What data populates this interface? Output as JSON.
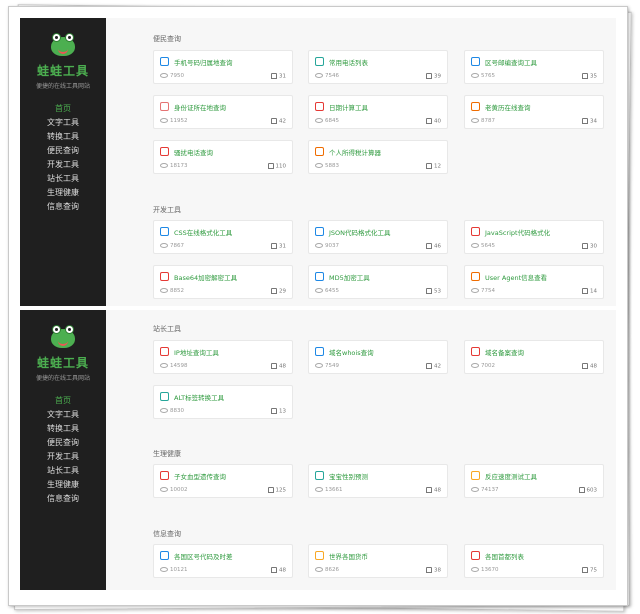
{
  "sidebar": {
    "brand": "蛙蛙工具",
    "slogan": "便捷的在线工具网站",
    "nav": [
      "首页",
      "文字工具",
      "转换工具",
      "便民查询",
      "开发工具",
      "站长工具",
      "生理健康",
      "信息查询"
    ]
  },
  "shot1": {
    "sections": [
      {
        "title": "便民查询",
        "cards": [
          {
            "name": "手机号码归属地查询",
            "views": "7950",
            "likes": "31",
            "icon": "phone-icon",
            "color": "#1e88e5"
          },
          {
            "name": "常用电话列表",
            "views": "7546",
            "likes": "39",
            "icon": "call-icon",
            "color": "#26a69a"
          },
          {
            "name": "区号邮编查询工具",
            "views": "5765",
            "likes": "35",
            "icon": "mail-icon",
            "color": "#1e88e5"
          },
          {
            "name": "身份证所在地查询",
            "views": "11952",
            "likes": "42",
            "icon": "idcard-icon",
            "color": "#e57373"
          },
          {
            "name": "日期计算工具",
            "views": "6845",
            "likes": "40",
            "icon": "calendar-icon",
            "color": "#e53935"
          },
          {
            "name": "老黄历在线查询",
            "views": "8787",
            "likes": "34",
            "icon": "almanac-icon",
            "color": "#ef6c00"
          },
          {
            "name": "骚扰电话查询",
            "views": "18173",
            "likes": "110",
            "icon": "block-icon",
            "color": "#e53935"
          },
          {
            "name": "个人所得税计算器",
            "views": "5883",
            "likes": "12",
            "icon": "tax-icon",
            "color": "#ef6c00"
          }
        ]
      },
      {
        "title": "开发工具",
        "cards": [
          {
            "name": "CSS在线格式化工具",
            "views": "7867",
            "likes": "31",
            "icon": "css-icon",
            "color": "#1e88e5"
          },
          {
            "name": "JSON代码格式化工具",
            "views": "9037",
            "likes": "46",
            "icon": "json-icon",
            "color": "#1e88e5"
          },
          {
            "name": "JavaScript代码格式化",
            "views": "5645",
            "likes": "30",
            "icon": "js-icon",
            "color": "#e53935"
          },
          {
            "name": "Base64加密解密工具",
            "views": "8852",
            "likes": "29",
            "icon": "lock-icon",
            "color": "#e53935"
          },
          {
            "name": "MD5加密工具",
            "views": "6455",
            "likes": "53",
            "icon": "key-icon",
            "color": "#1e88e5"
          },
          {
            "name": "User Agent信息查看",
            "views": "7754",
            "likes": "14",
            "icon": "user-agent-icon",
            "color": "#ef6c00"
          }
        ]
      }
    ]
  },
  "shot2": {
    "sections": [
      {
        "title": "站长工具",
        "cards": [
          {
            "name": "IP地址查询工具",
            "views": "14598",
            "likes": "48",
            "icon": "ip-icon",
            "color": "#e53935"
          },
          {
            "name": "域名whois查询",
            "views": "7549",
            "likes": "42",
            "icon": "web-icon",
            "color": "#1e88e5"
          },
          {
            "name": "域名备案查询",
            "views": "7002",
            "likes": "48",
            "icon": "medal-icon",
            "color": "#e53935"
          },
          {
            "name": "ALT标签转换工具",
            "views": "8830",
            "likes": "13",
            "icon": "image-icon",
            "color": "#26a69a"
          }
        ]
      },
      {
        "title": "生理健康",
        "cards": [
          {
            "name": "子女血型遗传查询",
            "views": "10002",
            "likes": "125",
            "icon": "drop-icon",
            "color": "#e53935"
          },
          {
            "name": "宝宝性别预测",
            "views": "13661",
            "likes": "48",
            "icon": "baby-icon",
            "color": "#26a69a"
          },
          {
            "name": "反应速度测试工具",
            "views": "74137",
            "likes": "603",
            "icon": "eye-icon",
            "color": "#f9a825"
          }
        ]
      },
      {
        "title": "信息查询",
        "cards": [
          {
            "name": "各国区号代码及时差",
            "views": "10121",
            "likes": "48",
            "icon": "clock-icon",
            "color": "#1e88e5"
          },
          {
            "name": "世界各国货币",
            "views": "8626",
            "likes": "38",
            "icon": "coin-icon",
            "color": "#f9a825"
          },
          {
            "name": "各国首都列表",
            "views": "13670",
            "likes": "75",
            "icon": "flag-icon",
            "color": "#e53935"
          }
        ]
      }
    ]
  }
}
